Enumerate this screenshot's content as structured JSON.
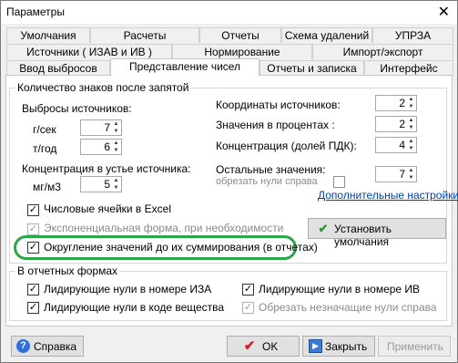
{
  "window": {
    "title": "Параметры",
    "close_glyph": "✕"
  },
  "tabs": {
    "row1": [
      "Умолчания",
      "Расчеты",
      "Отчеты",
      "Схема удалений",
      "УПРЗА"
    ],
    "row2": [
      "Источники ( ИЗАВ и ИВ )",
      "Нормирование",
      "Импорт/экспорт"
    ],
    "row3": [
      "Ввод выбросов",
      "Представление чисел",
      "Отчеты и записка",
      "Интерфейс"
    ],
    "active": "Представление чисел"
  },
  "decimals_group": {
    "title": "Количество знаков после запятой",
    "emissions_label": "Выбросы источников:",
    "gsec_label": "г/сек",
    "gsec_value": "7",
    "tyear_label": "т/год",
    "tyear_value": "6",
    "conc_label": "Концентрация в устье источника:",
    "mgm3_label": "мг/м3",
    "mgm3_value": "5",
    "coords_label": "Координаты источников:",
    "coords_value": "2",
    "percent_label": "Значения  в процентах :",
    "percent_value": "2",
    "pdk_label": "Концентрация (долей ПДК):",
    "pdk_value": "4",
    "other_label": "Остальные значения:",
    "other_value": "7",
    "trim_zeros_label": "обрезать нули справа",
    "extra_settings_link": "Дополнительные настройки",
    "excel_label": "Числовые ячейки в Excel",
    "exp_label": "Экспоненциальная форма, при необходимости",
    "rounding_label": "Округление значений до их суммирования (в отчетах)",
    "set_defaults_button": "Установить умолчания"
  },
  "reports_group": {
    "title": "В отчетных формах",
    "lead_iza_label": "Лидирующие нули в номере ИЗА",
    "lead_iv_label": "Лидирующие нули в номере ИВ",
    "lead_code_label": "Лидирующие нули в коде вещества",
    "trim_label": "Обрезать незначащие нули справа"
  },
  "buttons": {
    "help": "Справка",
    "ok": "OK",
    "close": "Закрыть",
    "apply": "Применить"
  },
  "colors": {
    "highlight": "#2ca64a",
    "link": "#0044aa",
    "ok_check": "#d0202a",
    "defaults_check": "#2a9a2a"
  }
}
